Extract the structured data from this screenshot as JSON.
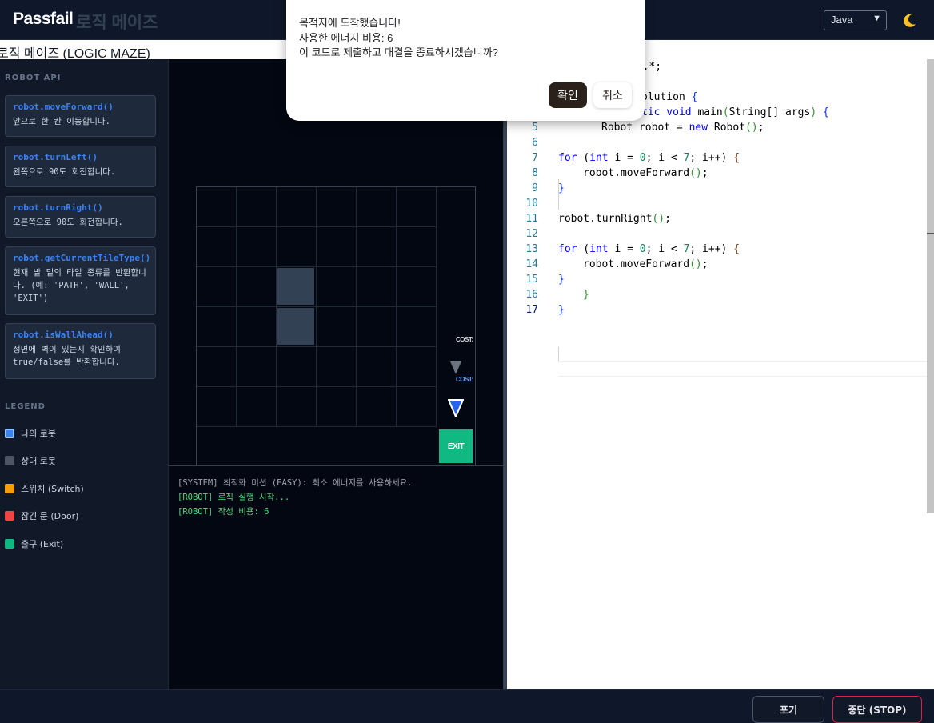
{
  "header": {
    "brand": "Passfail",
    "brand_sub": "로직 메이즈",
    "language": "Java"
  },
  "page_title": "로직 메이즈 (LOGIC MAZE)",
  "sidebar": {
    "api_title": "ROBOT API",
    "api": [
      {
        "name": "robot.moveForward()",
        "desc": "앞으로 한 칸 이동합니다."
      },
      {
        "name": "robot.turnLeft()",
        "desc": "왼쪽으로 90도 회전합니다."
      },
      {
        "name": "robot.turnRight()",
        "desc": "오른쪽으로 90도 회전합니다."
      },
      {
        "name": "robot.getCurrentTileType()",
        "desc": "현재 발 밑의 타일 종류를 반환합니다. (예: 'PATH', 'WALL', 'EXIT')"
      },
      {
        "name": "robot.isWallAhead()",
        "desc": "정면에 벽이 있는지 확인하여 true/false를 반환합니다."
      }
    ],
    "legend_title": "LEGEND",
    "legend": [
      {
        "label": "나의 로봇",
        "color": "#3b82f6"
      },
      {
        "label": "상대 로봇",
        "color": "#4b5563"
      },
      {
        "label": "스위치 (Switch)",
        "color": "#f59e0b"
      },
      {
        "label": "잠긴 문 (Door)",
        "color": "#ef4444"
      },
      {
        "label": "출구 (Exit)",
        "color": "#10b981"
      }
    ]
  },
  "maze": {
    "exit_label": "EXIT",
    "opponent_cost_label": "COST:",
    "my_cost_label": "COST:"
  },
  "console": {
    "lines": [
      {
        "text": "[SYSTEM] 최적화 미션 (EASY): 최소 에너지를 사용하세요.",
        "color": "#9ca3af"
      },
      {
        "text": "[ROBOT] 로직 실행 시작...",
        "color": "#4ade80"
      },
      {
        "text": "[ROBOT] 작성 비용: 6",
        "color": "#4ade80"
      }
    ]
  },
  "editor": {
    "line_numbers": [
      "5",
      "6",
      "7",
      "8",
      "9",
      "10",
      "11",
      "12",
      "13",
      "14",
      "15",
      "16",
      "17"
    ],
    "frag_import": "il.*;",
    "frag_class": "olution {",
    "frag_main": "tic void main(String[] args) {",
    "code": [
      "Robot robot = new Robot();",
      "",
      "for (int i = 0; i < 7; i++) {",
      "robot.moveForward();",
      "}",
      "",
      "robot.turnRight();",
      "",
      "for (int i = 0; i < 7; i++) {",
      "robot.moveForward();",
      "}",
      "}",
      "}"
    ]
  },
  "footer": {
    "give_up": "포기",
    "stop": "중단 (STOP)"
  },
  "dialog": {
    "line1": "목적지에 도착했습니다!",
    "line2": "사용한 에너지 비용: 6",
    "line3": "이 코드로 제출하고 대결을 종료하시겠습니까?",
    "confirm": "확인",
    "cancel": "취소"
  }
}
